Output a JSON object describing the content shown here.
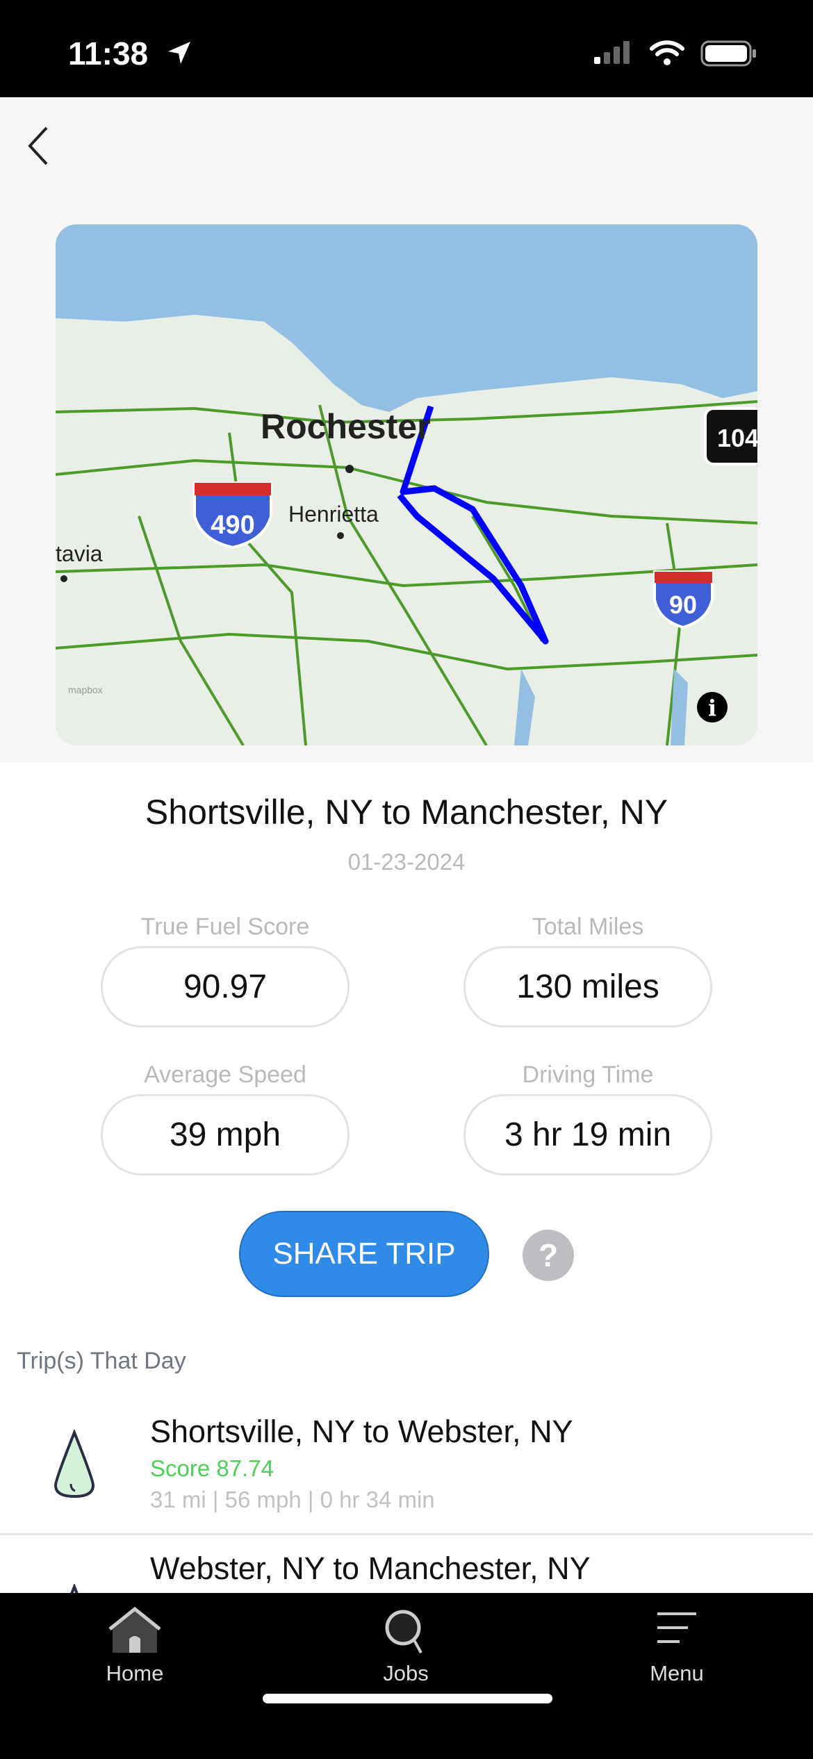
{
  "status_bar": {
    "time": "11:38"
  },
  "map": {
    "labels": {
      "city_main": "Rochester",
      "city_2": "Henrietta",
      "city_3": "tavia",
      "shield_490": "490",
      "shield_90": "90",
      "shield_104": "104",
      "attribution": "mapbox"
    },
    "route_color": "#0000ff"
  },
  "trip": {
    "title": "Shortsville, NY to Manchester, NY",
    "date": "01-23-2024"
  },
  "stats": [
    {
      "label": "True Fuel Score",
      "value": "90.97"
    },
    {
      "label": "Total Miles",
      "value": "130 miles"
    },
    {
      "label": "Average Speed",
      "value": "39 mph"
    },
    {
      "label": "Driving Time",
      "value": "3 hr 19 min"
    }
  ],
  "share_label": "SHARE TRIP",
  "help_label": "?",
  "section_title": "Trip(s) That Day",
  "trips": [
    {
      "title": "Shortsville, NY to Webster, NY",
      "score": "Score 87.74",
      "meta": "31 mi | 56 mph | 0 hr 34 min"
    },
    {
      "title": "Webster, NY to Manchester, NY"
    }
  ],
  "tabs": [
    {
      "label": "Home",
      "icon": "home-icon"
    },
    {
      "label": "Jobs",
      "icon": "search-icon"
    },
    {
      "label": "Menu",
      "icon": "menu-icon"
    }
  ],
  "colors": {
    "accent": "#2f8ae8",
    "score_green": "#4cd057"
  }
}
